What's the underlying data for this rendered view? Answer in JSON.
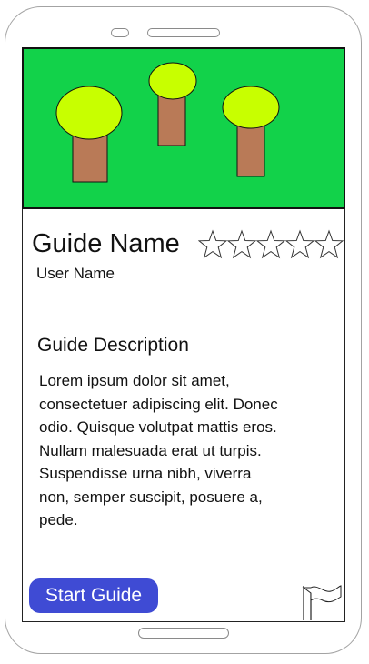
{
  "guide": {
    "name": "Guide Name",
    "user": "User Name",
    "rating_max": 5,
    "rating_value": 0,
    "description_title": "Guide Description",
    "description": "Lorem ipsum dolor sit amet, consectetuer adipiscing elit. Donec odio. Quisque volutpat mattis eros. Nullam malesuada erat ut turpis. Suspendisse urna nibh, viverra non, semper suscipit, posuere a, pede."
  },
  "actions": {
    "start_label": "Start Guide",
    "report_icon": "flag-icon"
  },
  "colors": {
    "hero_background": "#12d24a",
    "tree_canopy": "#c8ff00",
    "tree_trunk": "#b97a57",
    "button": "#3f4bd4"
  }
}
